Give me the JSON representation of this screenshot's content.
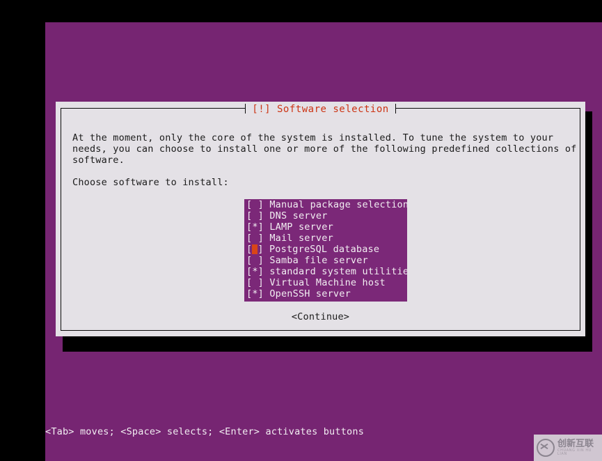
{
  "screen": {
    "background_color": "#000000",
    "console_color": "#762572",
    "panel_color": "#e4e1e6",
    "accent_color": "#cc3414",
    "cursor_color": "#d94518",
    "list_color": "#7b2878"
  },
  "dialog": {
    "title": "[!] Software selection",
    "body_paragraph": "At the moment, only the core of the system is installed. To tune the system to your\nneeds, you can choose to install one or more of the following predefined collections of\nsoftware.",
    "prompt": "Choose software to install:",
    "continue_label": "<Continue>"
  },
  "software_list": {
    "items": [
      {
        "marker": "[ ]",
        "label": "Manual package selection",
        "checked": false,
        "focused": false
      },
      {
        "marker": "[ ]",
        "label": "DNS server",
        "checked": false,
        "focused": false
      },
      {
        "marker": "[*]",
        "label": "LAMP server",
        "checked": true,
        "focused": false
      },
      {
        "marker": "[ ]",
        "label": "Mail server",
        "checked": false,
        "focused": false
      },
      {
        "marker": "[ ]",
        "label": "PostgreSQL database",
        "checked": false,
        "focused": true
      },
      {
        "marker": "[ ]",
        "label": "Samba file server",
        "checked": false,
        "focused": false
      },
      {
        "marker": "[*]",
        "label": "standard system utilities",
        "checked": true,
        "focused": false
      },
      {
        "marker": "[ ]",
        "label": "Virtual Machine host",
        "checked": false,
        "focused": false
      },
      {
        "marker": "[*]",
        "label": "OpenSSH server",
        "checked": true,
        "focused": false
      }
    ]
  },
  "footer": {
    "help_text": "<Tab> moves; <Space> selects; <Enter> activates buttons"
  },
  "watermark": {
    "logo_glyph": "logo-x-icon",
    "name_cn": "创新互联",
    "name_en": "CHUANG XIN HU LIAN"
  }
}
